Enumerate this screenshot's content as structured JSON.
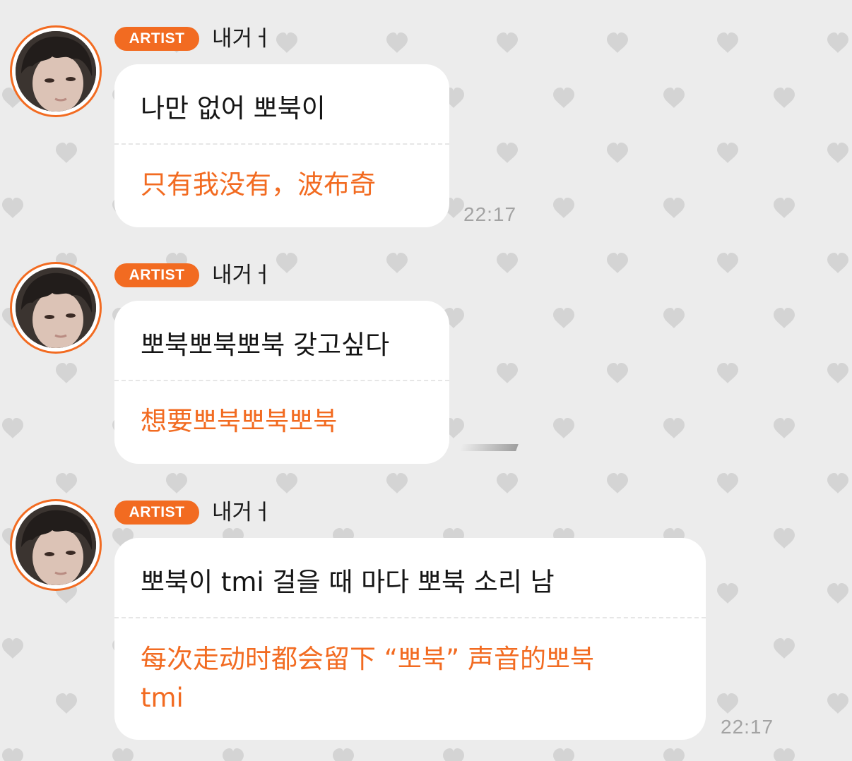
{
  "colors": {
    "accent": "#f26b21",
    "background": "#ececec",
    "bubble": "#ffffff",
    "heart": "#d4d4d4",
    "timestamp": "#a3a3a3"
  },
  "background_icon": "heart-icon",
  "messages": [
    {
      "badge": "ARTIST",
      "sender": "내거ㅓ",
      "korean": "나만 없어 뽀북이",
      "chinese": [
        "只有我没有，波布奇"
      ],
      "time": "22:17"
    },
    {
      "badge": "ARTIST",
      "sender": "내거ㅓ",
      "korean": "뽀북뽀북뽀북 갖고싶다",
      "chinese": [
        "想要뽀북뽀북뽀북"
      ],
      "time": ""
    },
    {
      "badge": "ARTIST",
      "sender": "내거ㅓ",
      "korean": "뽀북이 tmi 걸을 때 마다 뽀북 소리 남",
      "chinese": [
        "每次走动时都会留下 “뽀북” 声音的뽀북",
        "tmi"
      ],
      "time": "22:17"
    }
  ]
}
